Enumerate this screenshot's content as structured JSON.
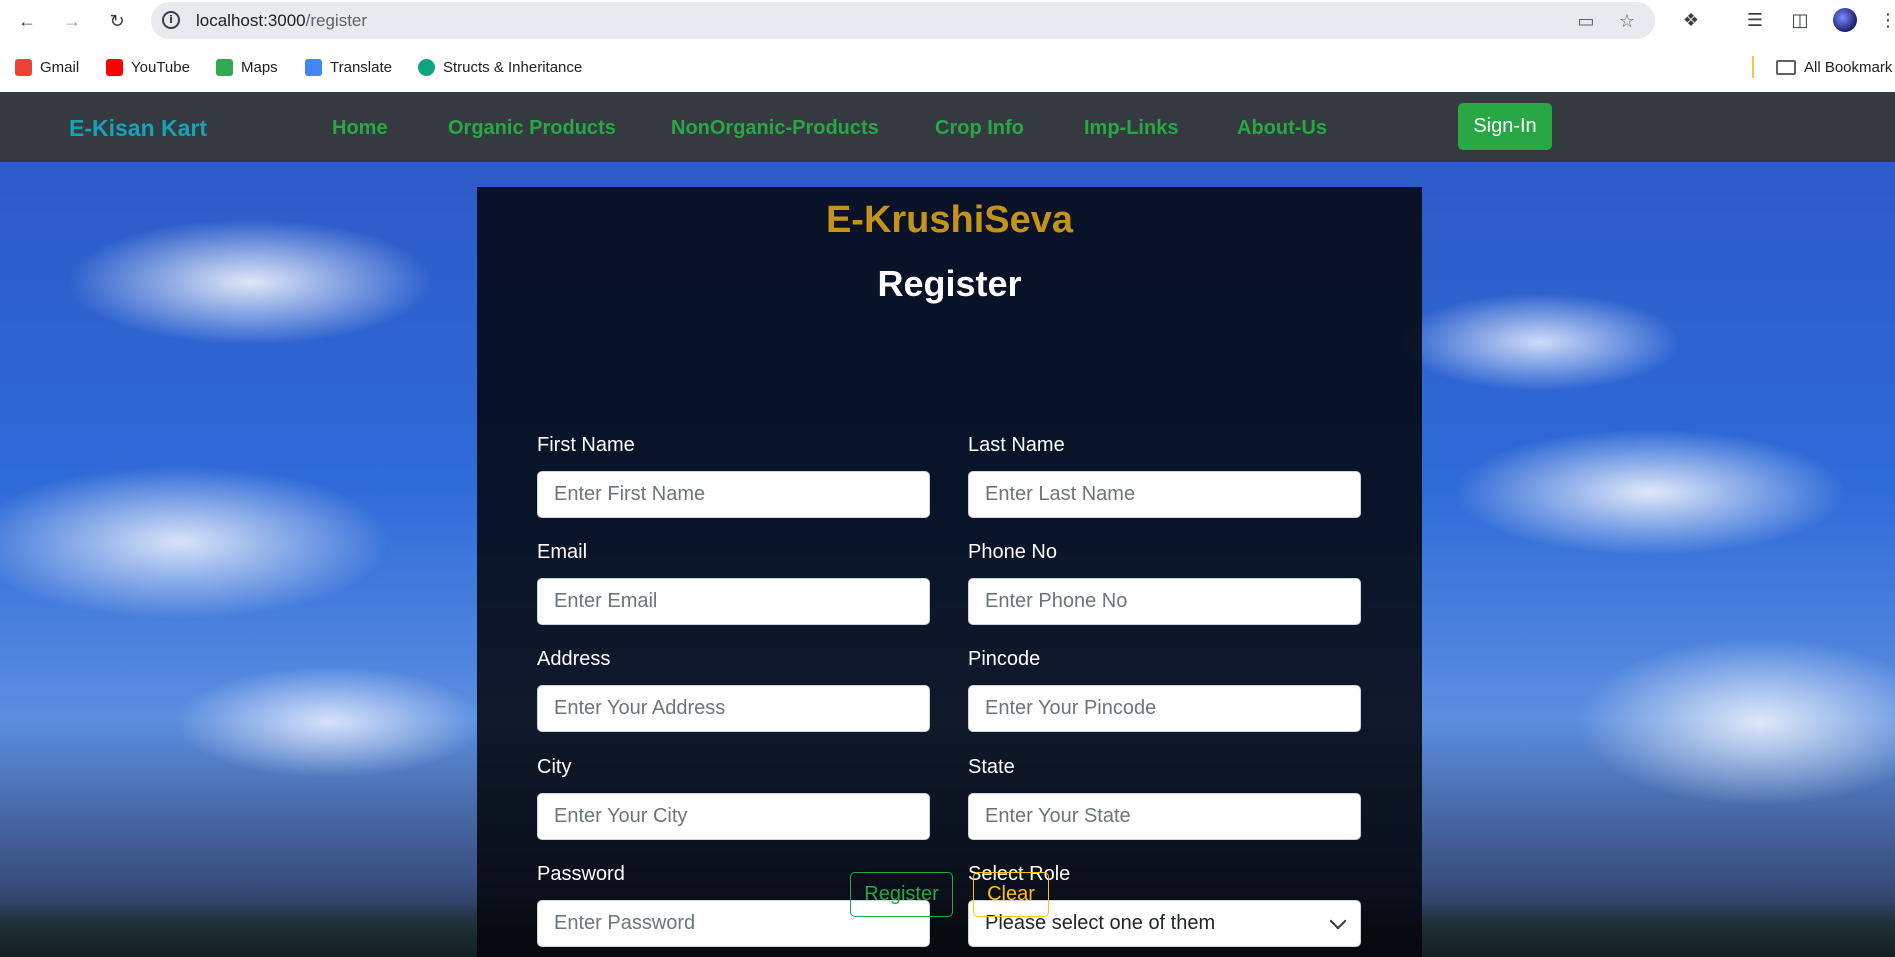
{
  "browser": {
    "url_host": "localhost:3000",
    "url_path": "/register",
    "bookmarks": [
      {
        "label": "Gmail",
        "icon": "gmail-icon",
        "color": "#ea4335"
      },
      {
        "label": "YouTube",
        "icon": "youtube-icon",
        "color": "#ff0000"
      },
      {
        "label": "Maps",
        "icon": "maps-icon",
        "color": "#34a853"
      },
      {
        "label": "Translate",
        "icon": "translate-icon",
        "color": "#4285f4"
      },
      {
        "label": "Structs & Inheritance",
        "icon": "chatgpt-icon",
        "color": "#10a37f"
      }
    ],
    "all_bookmarks": "All Bookmark"
  },
  "navbar": {
    "brand": "E-Kisan Kart",
    "links": [
      "Home",
      "Organic Products",
      "NonOrganic-Products",
      "Crop Info",
      "Imp-Links",
      "About-Us"
    ],
    "signin": "Sign-In"
  },
  "form": {
    "title": "E-KrushiSeva",
    "subtitle": "Register",
    "fields": {
      "first_name": {
        "label": "First Name",
        "placeholder": "Enter First Name"
      },
      "last_name": {
        "label": "Last Name",
        "placeholder": "Enter Last Name"
      },
      "email": {
        "label": "Email",
        "placeholder": "Enter Email"
      },
      "phone": {
        "label": "Phone No",
        "placeholder": "Enter Phone No"
      },
      "address": {
        "label": "Address",
        "placeholder": "Enter Your Address"
      },
      "pincode": {
        "label": "Pincode",
        "placeholder": "Enter Your Pincode"
      },
      "city": {
        "label": "City",
        "placeholder": "Enter Your City"
      },
      "state": {
        "label": "State",
        "placeholder": "Enter Your State"
      },
      "password": {
        "label": "Password",
        "placeholder": "Enter Password"
      },
      "role": {
        "label": "Select Role",
        "selected": "Please select one of them"
      }
    },
    "register_button": "Register",
    "clear_button": "Clear"
  },
  "colors": {
    "brand": "#17a2b8",
    "nav_link": "#28a745",
    "title": "#c6931a",
    "register": "#28a745",
    "clear": "#ffc107"
  }
}
